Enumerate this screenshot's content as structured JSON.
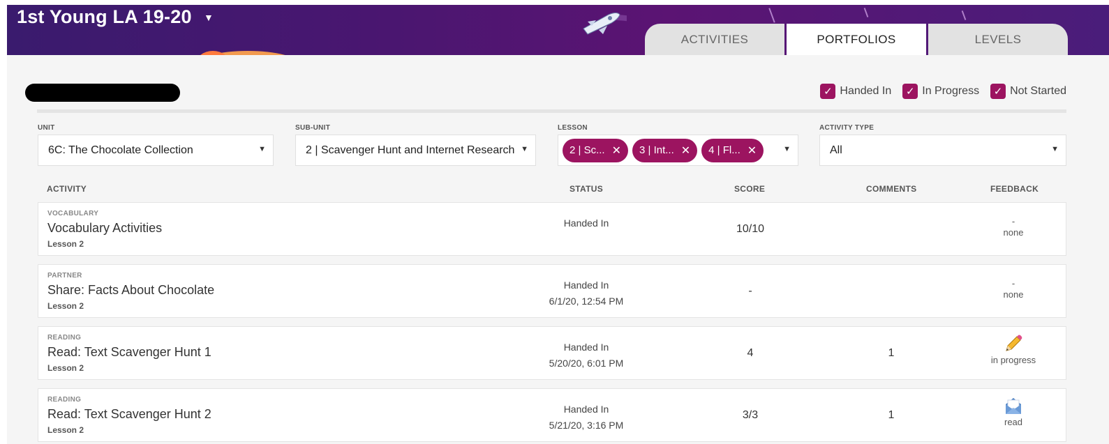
{
  "header": {
    "class_title": "1st Young LA 19-20",
    "tabs": [
      {
        "label": "ACTIVITIES",
        "active": false
      },
      {
        "label": "PORTFOLIOS",
        "active": true
      },
      {
        "label": "LEVELS",
        "active": false
      }
    ]
  },
  "status_filters": [
    {
      "label": "Handed In",
      "checked": true
    },
    {
      "label": "In Progress",
      "checked": true
    },
    {
      "label": "Not Started",
      "checked": true
    }
  ],
  "selectors": {
    "unit": {
      "label": "UNIT",
      "value": "6C: The Chocolate Collection"
    },
    "sub_unit": {
      "label": "SUB-UNIT",
      "value": "2 | Scavenger Hunt and Internet Research"
    },
    "lesson": {
      "label": "LESSON",
      "chips": [
        "2 | Sc...",
        "3 | Int...",
        "4 | Fl..."
      ]
    },
    "activity_type": {
      "label": "ACTIVITY TYPE",
      "value": "All"
    }
  },
  "table": {
    "columns": {
      "activity": "ACTIVITY",
      "status": "STATUS",
      "score": "SCORE",
      "comments": "COMMENTS",
      "feedback": "FEEDBACK"
    },
    "rows": [
      {
        "type": "VOCABULARY",
        "name": "Vocabulary Activities",
        "lesson": "Lesson 2",
        "status": "Handed In",
        "date": "",
        "score": "10/10",
        "comments": "",
        "feedback_mark": "-",
        "feedback": "none",
        "feedback_icon": ""
      },
      {
        "type": "PARTNER",
        "name": "Share: Facts About Chocolate",
        "lesson": "Lesson 2",
        "status": "Handed In",
        "date": "6/1/20, 12:54 PM",
        "score": "-",
        "comments": "",
        "feedback_mark": "-",
        "feedback": "none",
        "feedback_icon": ""
      },
      {
        "type": "READING",
        "name": "Read: Text Scavenger Hunt 1",
        "lesson": "Lesson 2",
        "status": "Handed In",
        "date": "5/20/20, 6:01 PM",
        "score": "4",
        "comments": "1",
        "feedback_mark": "",
        "feedback": "in progress",
        "feedback_icon": "pencil-icon"
      },
      {
        "type": "READING",
        "name": "Read: Text Scavenger Hunt 2",
        "lesson": "Lesson 2",
        "status": "Handed In",
        "date": "5/21/20, 3:16 PM",
        "score": "3/3",
        "comments": "1",
        "feedback_mark": "",
        "feedback": "read",
        "feedback_icon": "envelope-icon"
      }
    ]
  },
  "colors": {
    "accent": "#9c1460",
    "header": "#4a1670"
  }
}
